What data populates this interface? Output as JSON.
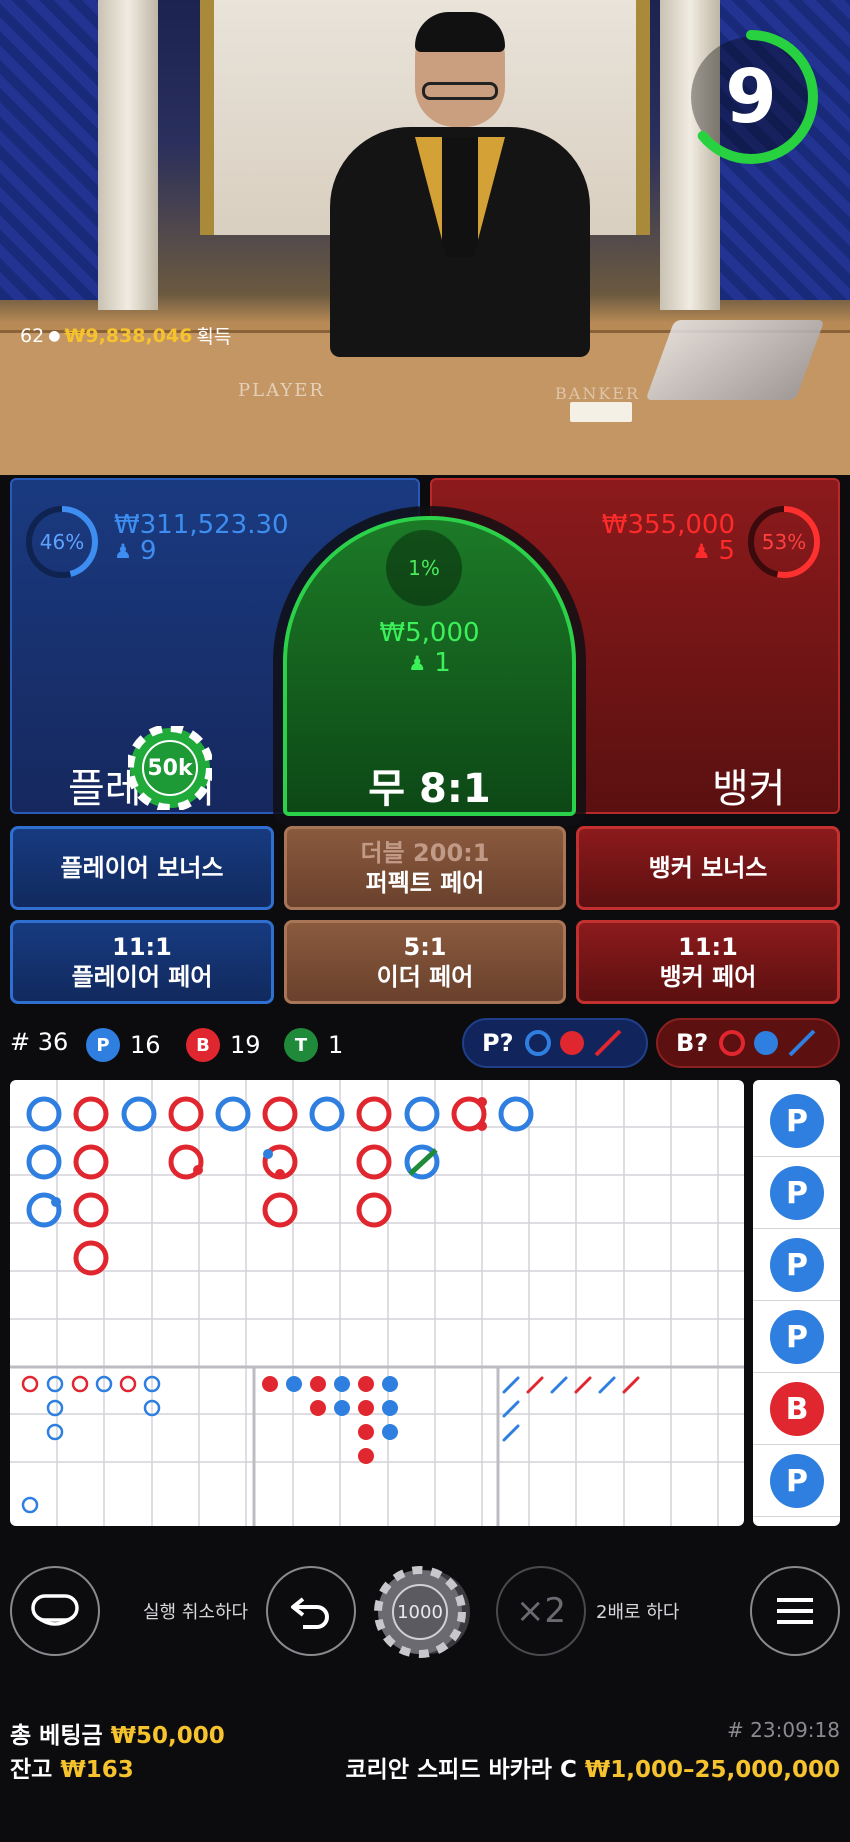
{
  "video": {
    "timer": "9",
    "table_player_text": "PLAYER",
    "table_banker_text": "BANKER",
    "winners_count": "62",
    "winners_amount": "₩9,838,046",
    "winners_suffix": "획득"
  },
  "bets": {
    "player": {
      "percent": "46%",
      "amount": "₩311,523.30",
      "players": "9",
      "label": "플레이어",
      "chip": "50k"
    },
    "tie": {
      "percent": "1%",
      "amount": "₩5,000",
      "players": "1",
      "label": "무 8:1"
    },
    "banker": {
      "percent": "53%",
      "amount": "₩355,000",
      "players": "5",
      "label": "뱅커"
    }
  },
  "side_bets": {
    "player_bonus": "플레이어 보너스",
    "perfect_pair_top": "더블 200:1",
    "perfect_pair": "퍼펙트 페어",
    "banker_bonus": "뱅커 보너스",
    "player_pair_odds": "11:1",
    "player_pair": "플레이어 페어",
    "either_pair_odds": "5:1",
    "either_pair": "이더 페어",
    "banker_pair_odds": "11:1",
    "banker_pair": "뱅커 페어"
  },
  "stats": {
    "total_label": "# 36",
    "p_letter": "P",
    "p_count": "16",
    "b_letter": "B",
    "b_count": "19",
    "t_letter": "T",
    "t_count": "1",
    "ask_player": "P?",
    "ask_banker": "B?"
  },
  "prediction_column": [
    "P",
    "P",
    "P",
    "P",
    "B",
    "P"
  ],
  "controls": {
    "undo_label": "실행 취소하다",
    "chip_value": "1000",
    "double_symbol": "×2",
    "double_label": "2배로 하다"
  },
  "footer": {
    "total_bet_label": "총 베팅금",
    "total_bet_value": "₩50,000",
    "balance_label": "잔고",
    "balance_value": "₩163",
    "round_id": "# 23:09:18",
    "table_name": "코리안 스피드 바카라 C",
    "limits": "₩1,000–25,000,000"
  },
  "colors": {
    "player_blue": "#2e7fe0",
    "banker_red": "#e0262e",
    "tie_green": "#1f8a3a",
    "gold": "#f6c22e",
    "timer_green": "#27d13f"
  }
}
